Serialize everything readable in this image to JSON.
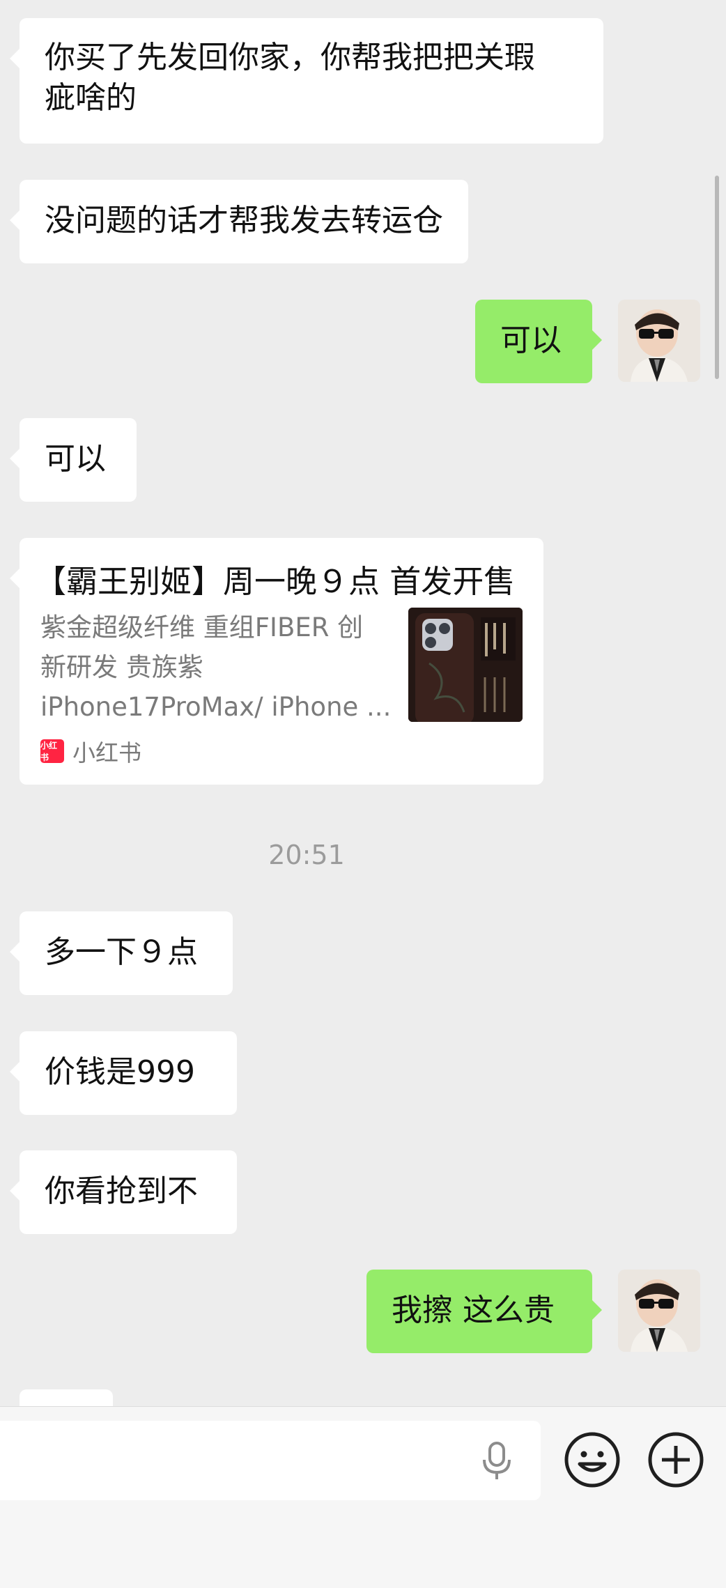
{
  "messages": {
    "m1_line1": "你买了先发回你家，你帮我把把关瑕",
    "m1_line2": "疵啥的",
    "m2": "没问题的话才帮我发去转运仓",
    "m3_out": "可以",
    "m4": "可以",
    "m5": "多一下９点",
    "m6": "价钱是999",
    "m7": "你看抢到不",
    "m8_out": "我擦 这么贵"
  },
  "link_card": {
    "title": "【霸王别姬】周一晚９点 首发开售",
    "desc_line1": "紫金超级纤维 重组FIBER 创",
    "desc_line2": "新研发 贵族紫",
    "desc_line3": "iPhone17ProMax/ iPhone ...",
    "source_logo_text": "小红书",
    "source": "小红书"
  },
  "timestamp": "20:51",
  "colors": {
    "incoming": "#ffffff",
    "outgoing": "#95ec69",
    "background": "#ededed",
    "source_brand": "#ff2442"
  },
  "icons": [
    "mic-icon",
    "emoji-icon",
    "plus-icon"
  ]
}
